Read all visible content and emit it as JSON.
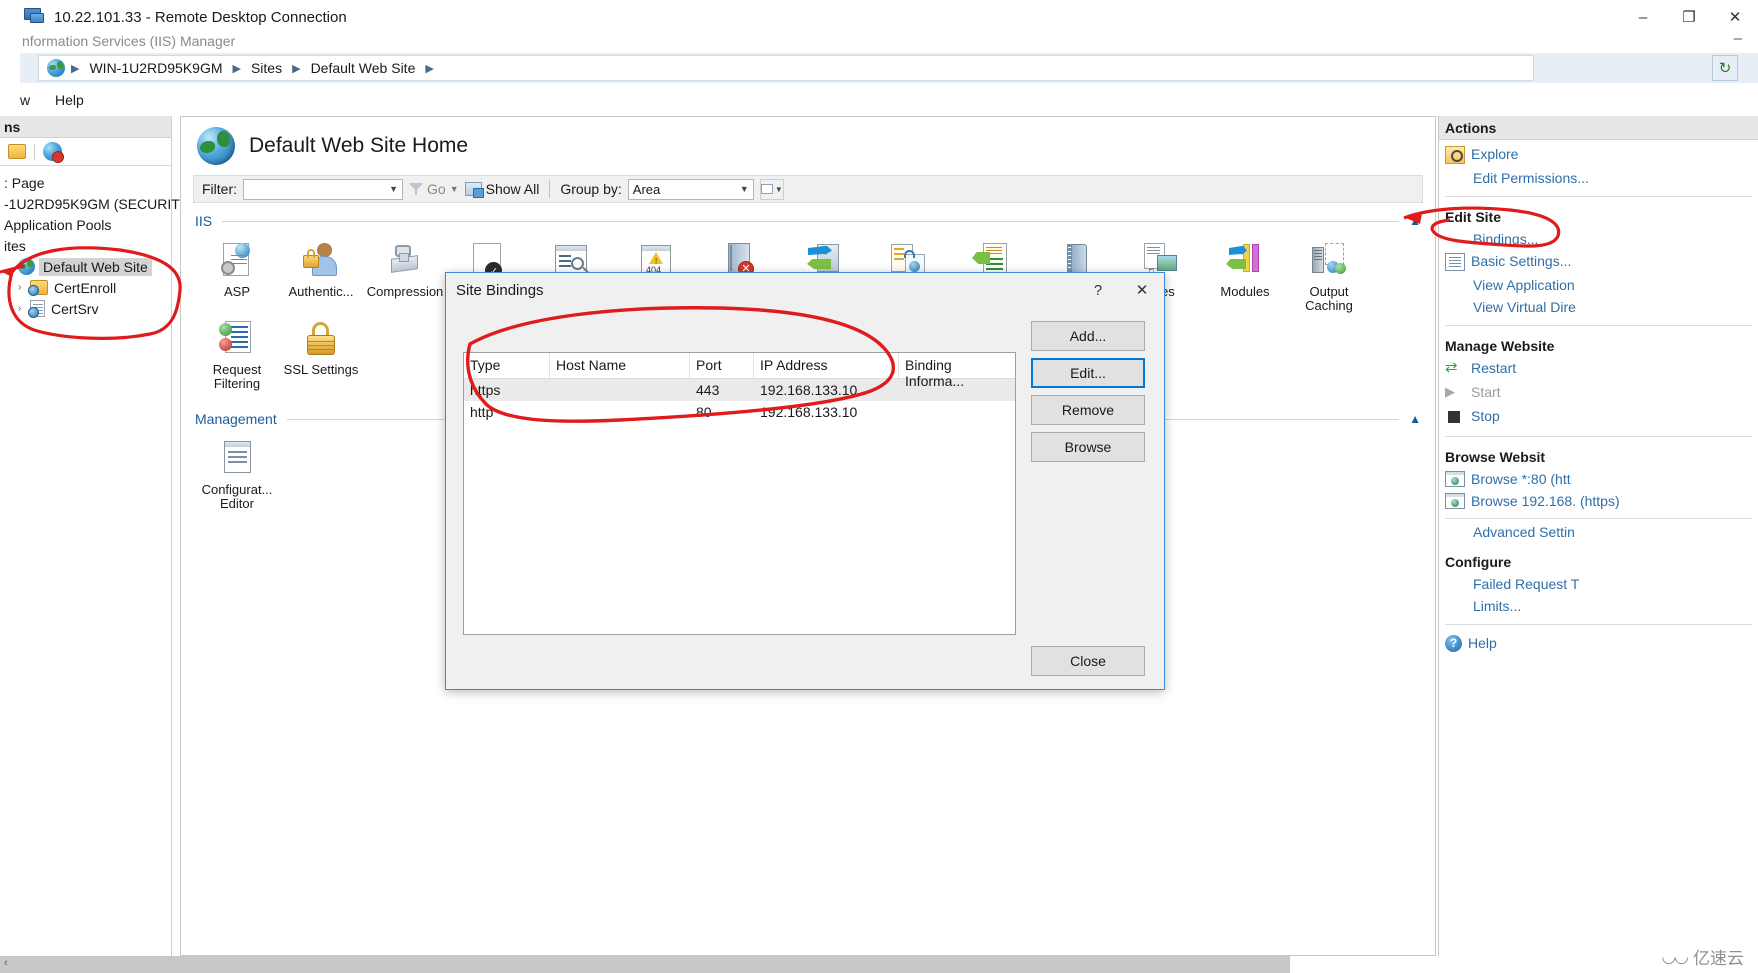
{
  "rdp": {
    "title": "10.22.101.33 - Remote Desktop Connection",
    "minimize": "–",
    "maximize": "❐",
    "close": "✕"
  },
  "iis_window": {
    "subtitle": "nformation Services (IIS) Manager",
    "minimize": "–"
  },
  "address_bar": {
    "globe_icon": "globe-icon",
    "crumbs": [
      "WIN-1U2RD95K9GM",
      "Sites",
      "Default Web Site"
    ],
    "separator": "▶",
    "refresh_icon": "refresh-icon"
  },
  "menubar": {
    "items": [
      "w",
      "Help"
    ]
  },
  "tree": {
    "header": "ns",
    "toolbar_icons": [
      "folder-icon",
      "disconnect-globe-icon"
    ],
    "nodes": [
      {
        "label": ": Page",
        "level": 1,
        "icon": "none",
        "chevron": "",
        "selected": false
      },
      {
        "label": "-1U2RD95K9GM (SECURIT",
        "level": 1,
        "icon": "none",
        "chevron": "",
        "selected": false
      },
      {
        "label": "Application Pools",
        "level": 1,
        "icon": "none",
        "chevron": "",
        "selected": false
      },
      {
        "label": "ites",
        "level": 1,
        "icon": "none",
        "chevron": "",
        "selected": false
      },
      {
        "label": "Default Web Site",
        "level": 2,
        "icon": "globe-icon",
        "chevron": "",
        "selected": true
      },
      {
        "label": "CertEnroll",
        "level": 2,
        "icon": "folder-app-icon",
        "chevron": "›",
        "selected": false
      },
      {
        "label": "CertSrv",
        "level": 2,
        "icon": "doc-app-icon",
        "chevron": "›",
        "selected": false
      }
    ]
  },
  "content": {
    "page_title": "Default Web Site Home",
    "page_icon": "globe-icon",
    "filter": {
      "label": "Filter:",
      "value": "",
      "placeholder": "",
      "dropdown_icon": "chevron-down-icon",
      "go_label": "Go",
      "go_icon": "funnel-icon",
      "go_arrow": "chevron-down-icon",
      "show_all_label": "Show All",
      "show_all_icon": "show-all-icon",
      "group_by_label": "Group by:",
      "group_by_value": "Area",
      "view_icon": "view-options-icon",
      "view_arrow": "chevron-down-icon"
    },
    "sections": [
      {
        "name": "IIS",
        "collapse_icon": "chevron-up-icon",
        "items": [
          {
            "label": "ASP",
            "icon": "asp-icon"
          },
          {
            "label": "Authentic...",
            "icon": "authentication-icon"
          },
          {
            "label": "Compression",
            "icon": "compression-icon"
          },
          {
            "label": "",
            "icon": "default-document-icon"
          },
          {
            "label": "",
            "icon": "directory-browsing-icon"
          },
          {
            "label": "",
            "icon": "error-pages-icon"
          },
          {
            "label": "",
            "icon": "failed-request-tracing-icon"
          },
          {
            "label": "",
            "icon": "handler-mappings-icon"
          },
          {
            "label": "",
            "icon": "http-redirect-icon"
          },
          {
            "label": "",
            "icon": "http-response-headers-icon"
          },
          {
            "label": "",
            "icon": "logging-icon"
          },
          {
            "label": "ypes",
            "icon": "mime-types-icon"
          },
          {
            "label": "Modules",
            "icon": "modules-icon"
          },
          {
            "label": "Output Caching",
            "icon": "output-caching-icon"
          },
          {
            "label": "Request Filtering",
            "icon": "request-filtering-icon"
          },
          {
            "label": "SSL Settings",
            "icon": "ssl-settings-icon"
          }
        ]
      },
      {
        "name": "Management",
        "collapse_icon": "chevron-up-icon",
        "items": [
          {
            "label": "Configurat... Editor",
            "icon": "configuration-editor-icon"
          }
        ]
      }
    ]
  },
  "dialog": {
    "title": "Site Bindings",
    "help_icon": "?",
    "close_icon": "✕",
    "columns": [
      "Type",
      "Host Name",
      "Port",
      "IP Address",
      "Binding Informa..."
    ],
    "rows": [
      {
        "type": "https",
        "host": "",
        "port": "443",
        "ip": "192.168.133.10",
        "binding": "",
        "selected": true
      },
      {
        "type": "http",
        "host": "",
        "port": "80",
        "ip": "192.168.133.10",
        "binding": "",
        "selected": false
      }
    ],
    "buttons": {
      "add": "Add...",
      "edit": "Edit...",
      "remove": "Remove",
      "browse": "Browse",
      "close": "Close"
    }
  },
  "actions": {
    "header": "Actions",
    "groups": [
      {
        "title": "",
        "items": [
          {
            "label": "Explore",
            "icon": "explore-icon",
            "disabled": false,
            "indent": false
          },
          {
            "label": "Edit Permissions...",
            "icon": "none",
            "disabled": false,
            "indent": true
          }
        ]
      },
      {
        "title": "Edit Site",
        "items": [
          {
            "label": "Bindings...",
            "icon": "none",
            "disabled": false,
            "indent": true
          },
          {
            "label": "Basic Settings...",
            "icon": "settings-icon",
            "disabled": false,
            "indent": false
          },
          {
            "label": "View Application",
            "icon": "none",
            "disabled": false,
            "indent": true
          },
          {
            "label": "View Virtual Dire",
            "icon": "none",
            "disabled": false,
            "indent": true
          }
        ]
      },
      {
        "title": "Manage Website",
        "items": [
          {
            "label": "Restart",
            "icon": "restart-icon",
            "disabled": false,
            "indent": false
          },
          {
            "label": "Start",
            "icon": "start-icon",
            "disabled": true,
            "indent": false
          },
          {
            "label": "Stop",
            "icon": "stop-icon",
            "disabled": false,
            "indent": false
          }
        ]
      },
      {
        "title": "Browse Websit",
        "items": [
          {
            "label": "Browse *:80 (htt",
            "icon": "browse-icon",
            "disabled": false,
            "indent": false
          },
          {
            "label": "Browse 192.168. (https)",
            "icon": "browse-icon",
            "disabled": false,
            "indent": false
          },
          {
            "label": "Advanced Settin",
            "icon": "none",
            "disabled": false,
            "indent": true
          }
        ]
      },
      {
        "title": "Configure",
        "items": [
          {
            "label": "Failed Request T",
            "icon": "none",
            "disabled": false,
            "indent": true
          },
          {
            "label": "Limits...",
            "icon": "none",
            "disabled": false,
            "indent": true
          }
        ]
      },
      {
        "title": "",
        "items": [
          {
            "label": "Help",
            "icon": "help-icon",
            "disabled": false,
            "indent": false
          }
        ]
      }
    ]
  },
  "annotations": {
    "color": "#e01b1b",
    "shapes": [
      "tree-sites-circle",
      "bindings-action-circle",
      "bindings-table-circle"
    ]
  },
  "watermark": {
    "text": "亿速云",
    "icon": "cloud-icon"
  },
  "bottom": {
    "scroll_left_arrow": "‹"
  }
}
